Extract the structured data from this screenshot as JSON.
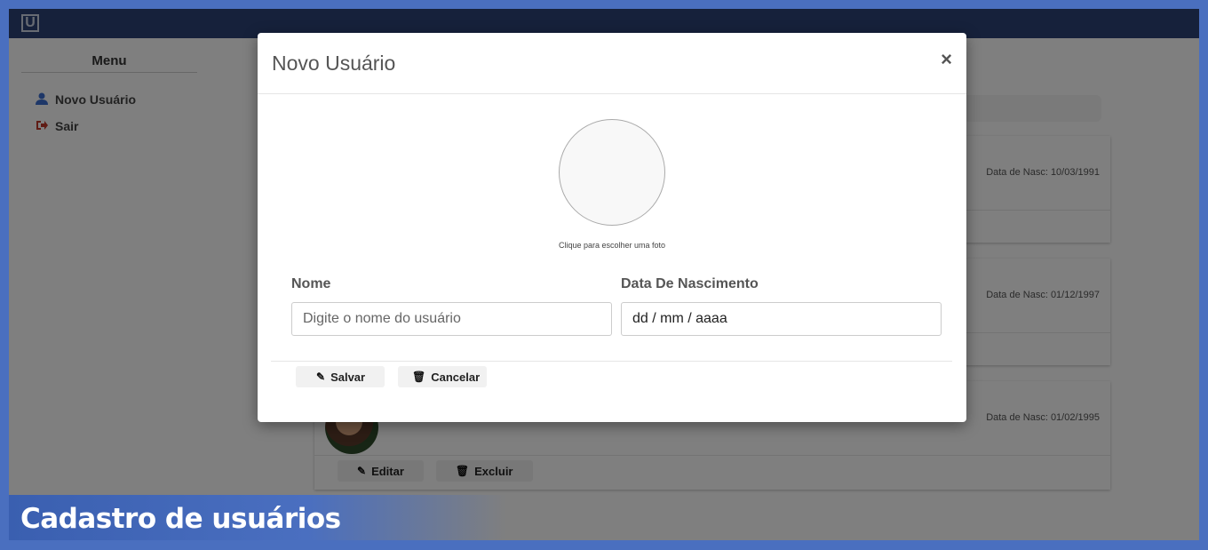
{
  "sidebar": {
    "title": "Menu",
    "items": [
      {
        "label": "Novo Usuário",
        "icon": "user-icon"
      },
      {
        "label": "Sair",
        "icon": "sign-out-icon"
      }
    ]
  },
  "cards": [
    {
      "nasc": "Data de Nasc: 10/03/1991"
    },
    {
      "nasc": "Data de Nasc: 01/12/1997"
    },
    {
      "nasc": "Data de Nasc: 01/02/1995",
      "edit_label": "Editar",
      "delete_label": "Excluir"
    }
  ],
  "modal": {
    "title": "Novo Usuário",
    "close": "×",
    "photo_hint": "Clique para escolher uma foto",
    "name_label": "Nome",
    "name_placeholder": "Digite o nome do usuário",
    "birth_label": "Data De Nascimento",
    "birth_placeholder": "dd / mm / aaaa",
    "save_label": "Salvar",
    "cancel_label": "Cancelar"
  },
  "caption": "Cadastro de usuários",
  "colors": {
    "topbar": "#2c4377",
    "frame": "#4a6fbf",
    "accent_user": "#3d6fd1",
    "accent_exit": "#c0392b"
  }
}
